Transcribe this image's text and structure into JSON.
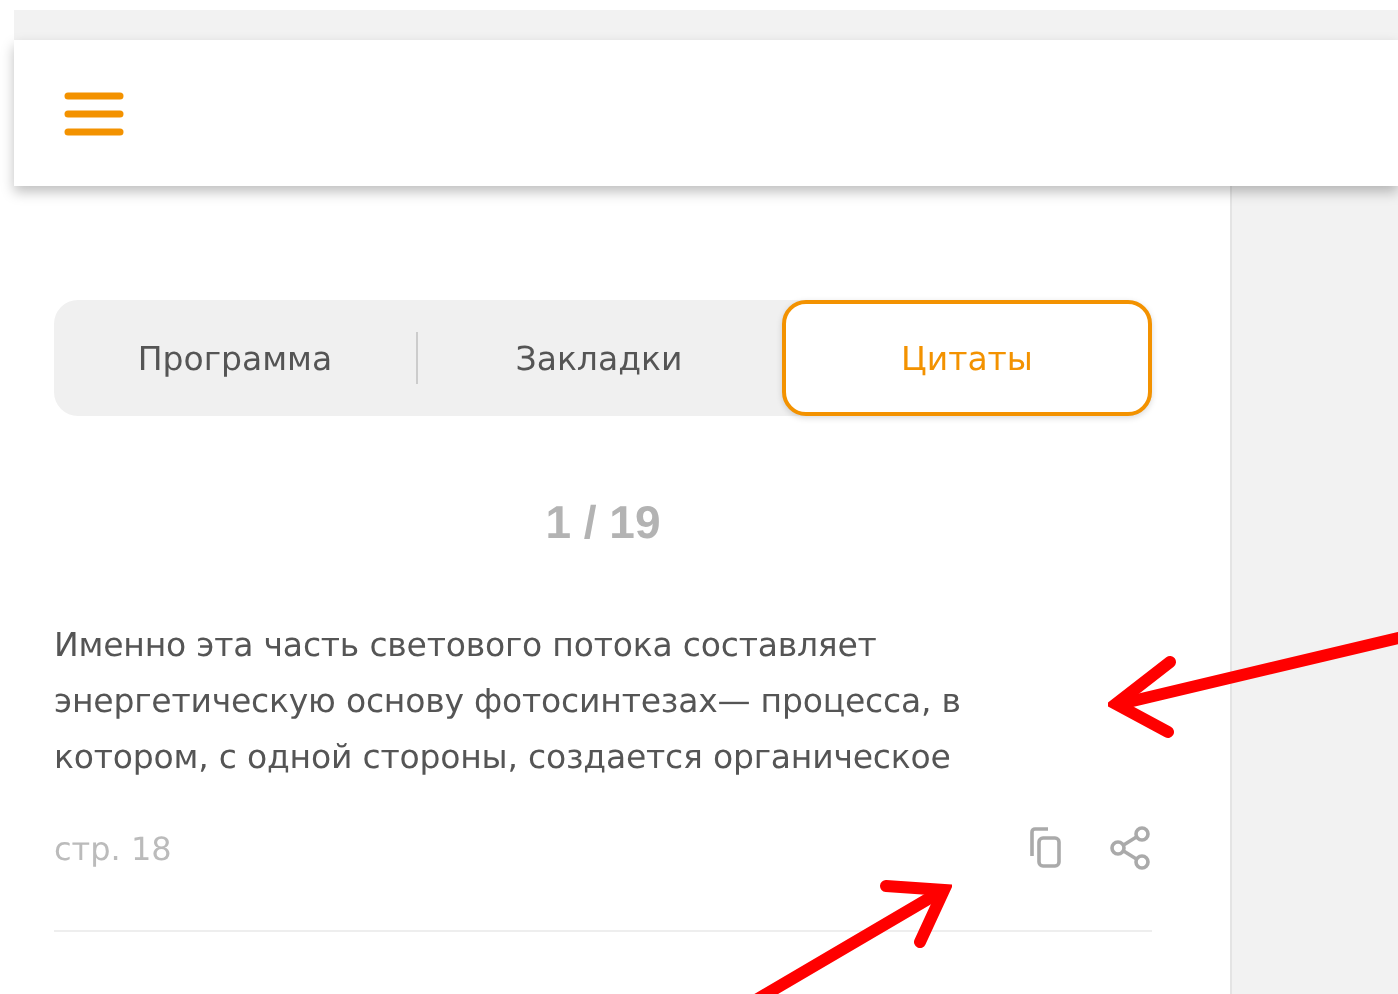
{
  "tabs": [
    {
      "label": "Программа",
      "selected": false
    },
    {
      "label": "Закладки",
      "selected": false
    },
    {
      "label": "Цитаты",
      "selected": true
    }
  ],
  "counter": "1 / 19",
  "quote": {
    "text": "Именно эта часть светового потока составляет энергетическую основу фотосинтезах— процесса, в котором, с одной стороны, создается органическое",
    "page": "стр. 18"
  }
}
